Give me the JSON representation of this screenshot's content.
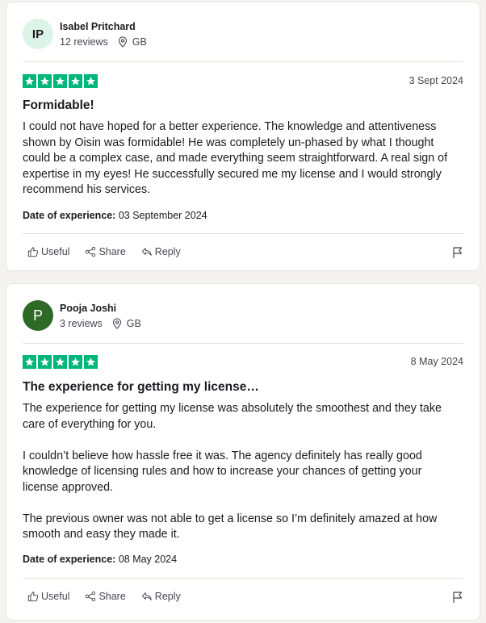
{
  "reviews": [
    {
      "initials": "IP",
      "name": "Isabel Pritchard",
      "review_count": "12 reviews",
      "country": "GB",
      "rating": 5,
      "date": "3 Sept 2024",
      "title": "Formidable!",
      "paragraphs": [
        "I could not have hoped for a better experience. The knowledge and attentiveness shown by Oisin was formidable! He was completely un-phased by what I thought could be a complex case, and made everything seem straightforward. A real sign of expertise in my eyes! He successfully secured me my license and I would strongly recommend his services."
      ],
      "date_of_experience_label": "Date of experience:",
      "date_of_experience": "03 September 2024",
      "avatar_color": "#dcf4e7"
    },
    {
      "initials": "P",
      "name": "Pooja Joshi",
      "review_count": "3 reviews",
      "country": "GB",
      "rating": 5,
      "date": "8 May 2024",
      "title": "The experience for getting my license…",
      "paragraphs": [
        "The experience for getting my license was absolutely the smoothest and they take care of everything for you.",
        "I couldn’t believe how hassle free it was. The agency definitely has really good knowledge of licensing rules and how to increase your chances of getting your license approved.",
        "The previous owner was not able to get a license so I’m definitely amazed at how smooth and easy they made it."
      ],
      "date_of_experience_label": "Date of experience:",
      "date_of_experience": "08 May 2024",
      "avatar_color": "#2d6a25"
    }
  ],
  "actions": {
    "useful": "Useful",
    "share": "Share",
    "reply": "Reply"
  },
  "colors": {
    "star": "#00b67a",
    "page_bg": "#f4f3ef"
  },
  "icons": [
    "location-pin-icon",
    "star-icon",
    "thumbs-up-icon",
    "share-icon",
    "reply-icon",
    "flag-icon"
  ]
}
